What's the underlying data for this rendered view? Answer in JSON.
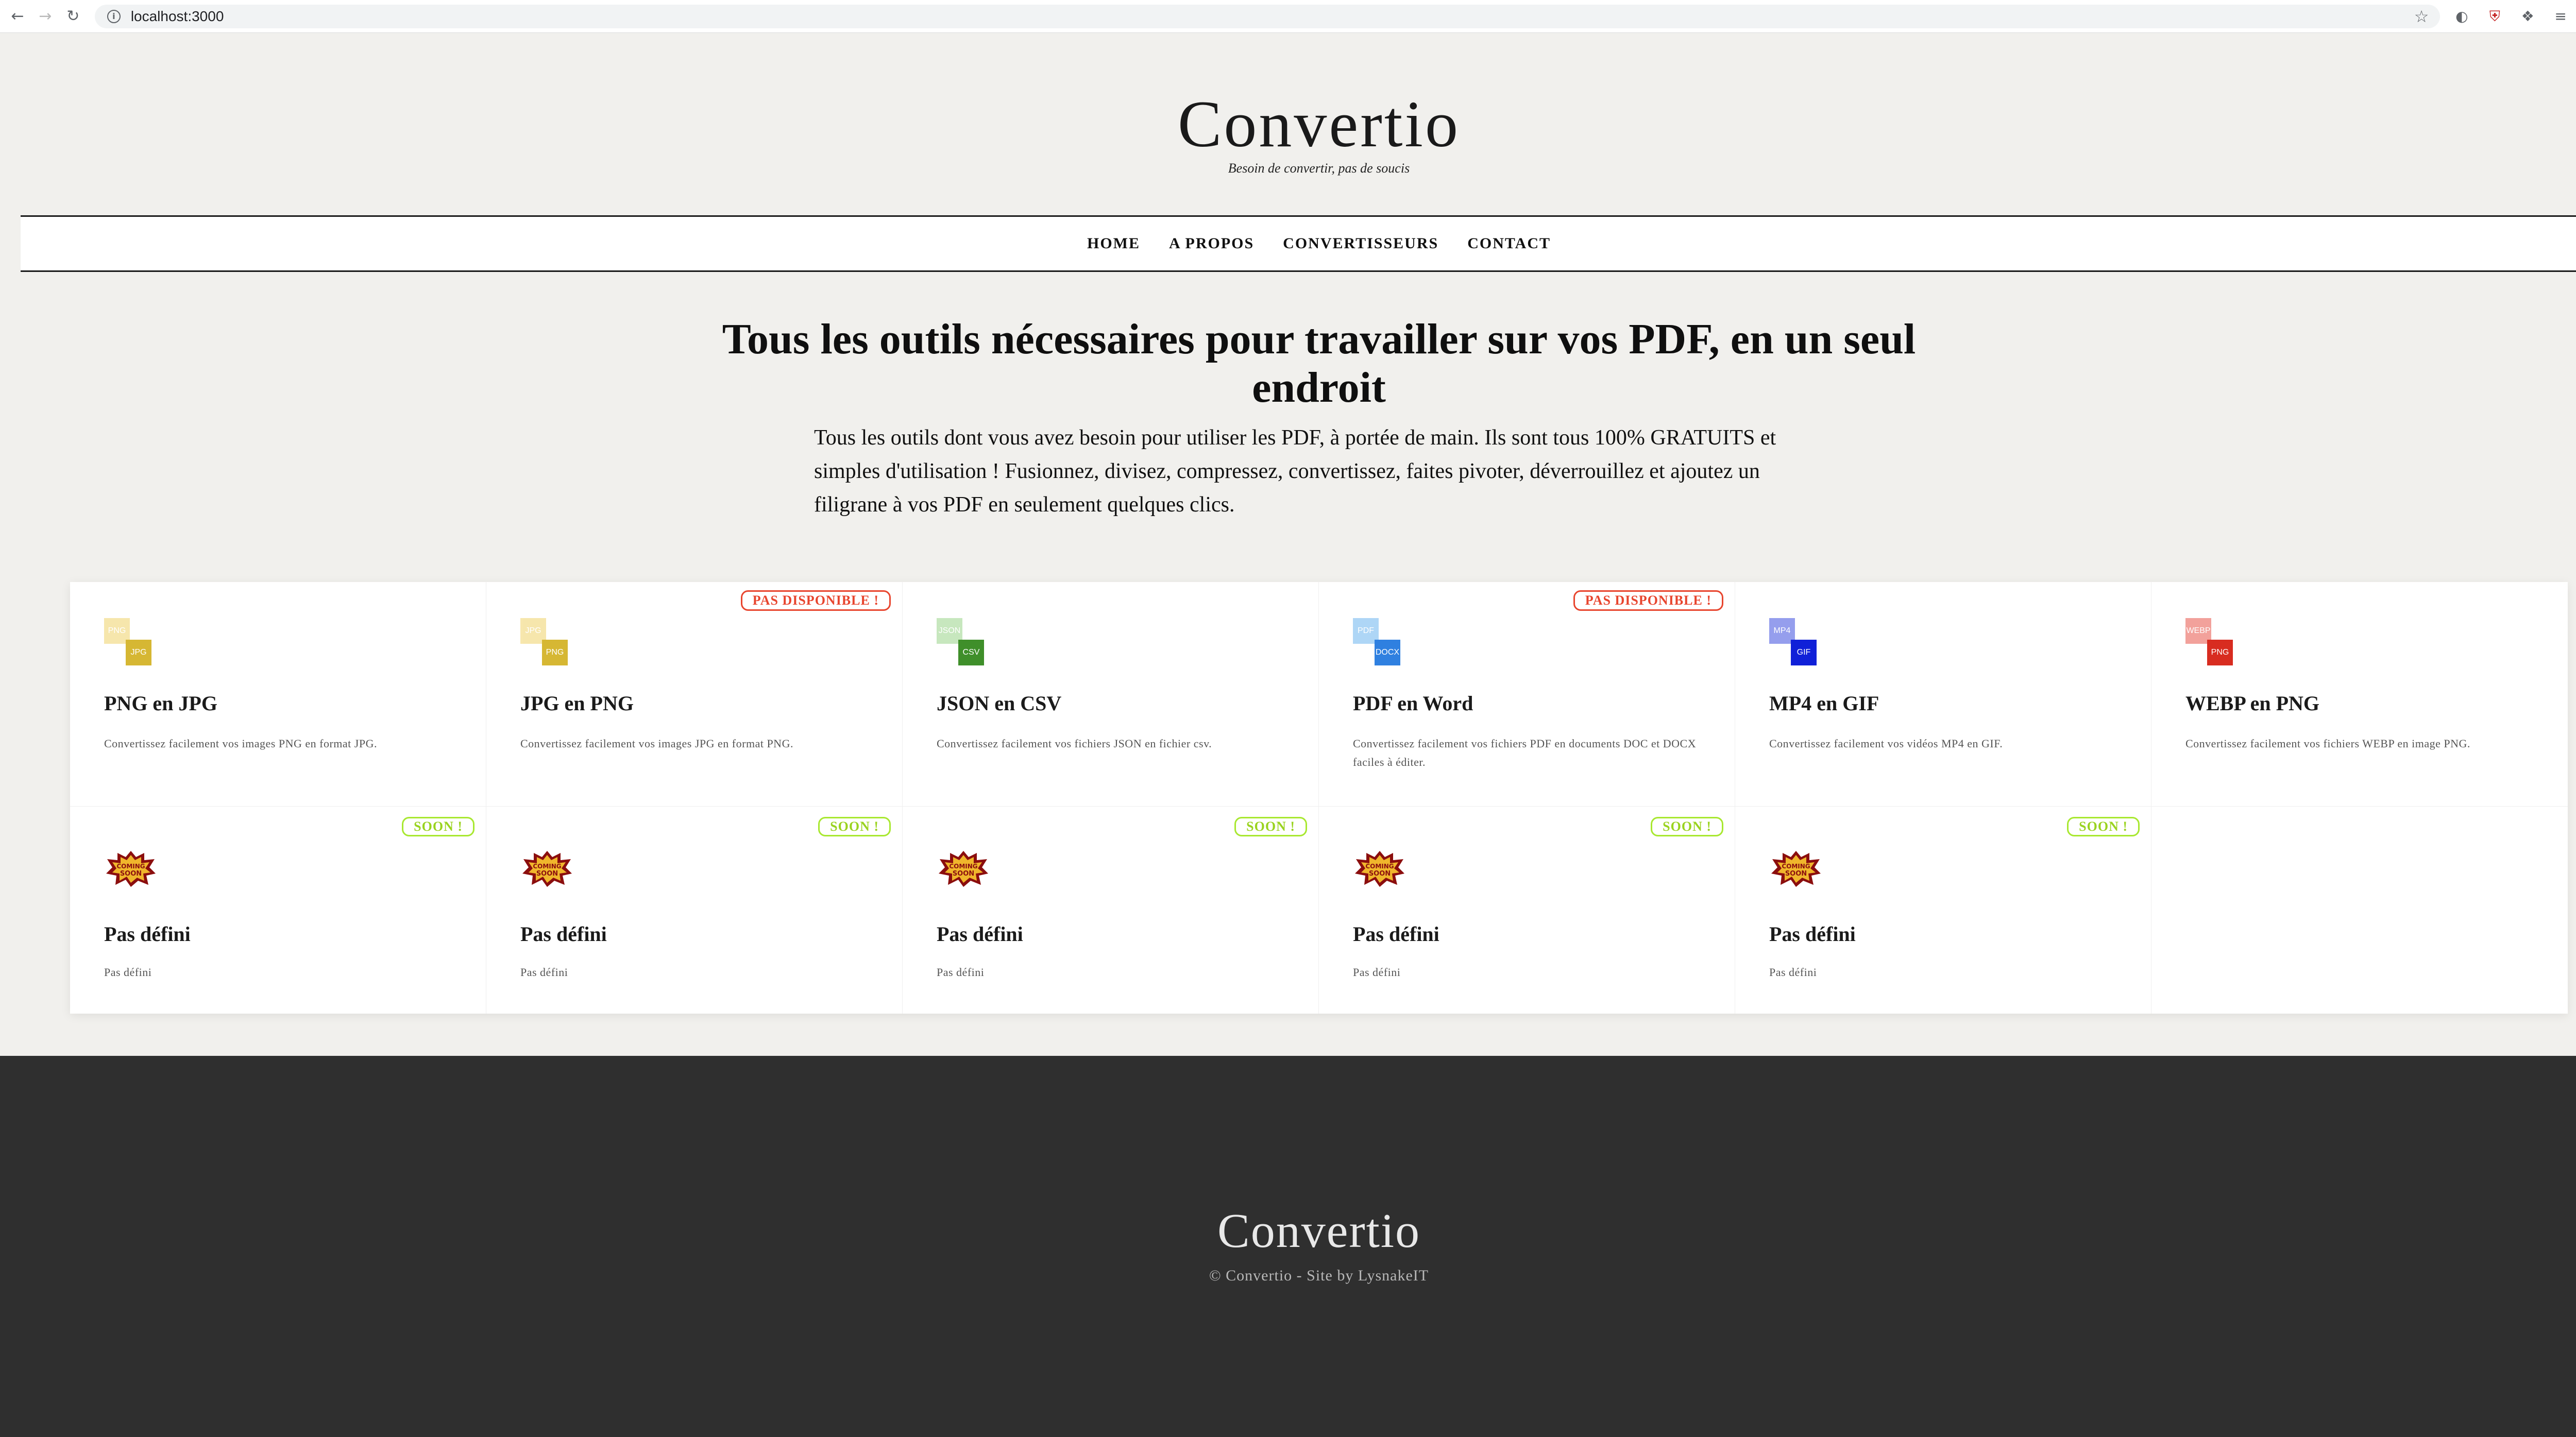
{
  "browser": {
    "url": "localhost:3000",
    "back_icon": "arrow-left",
    "forward_icon": "arrow-right",
    "reload_icon": "reload",
    "bookmark_icon": "star"
  },
  "header": {
    "brand": "Convertio",
    "tagline": "Besoin de convertir, pas de soucis"
  },
  "nav": {
    "items": [
      "HOME",
      "A PROPOS",
      "CONVERTISSEURS",
      "CONTACT"
    ]
  },
  "hero": {
    "title": "Tous les outils nécessaires pour travailler sur vos PDF, en un seul endroit",
    "description": "Tous les outils dont vous avez besoin pour utiliser les PDF, à portée de main. Ils sont tous 100% GRATUITS et simples d'utilisation ! Fusionnez, divisez, compressez, convertissez, faites pivoter, déverrouillez et ajoutez un filigrane à vos PDF en seulement quelques clics."
  },
  "converters": [
    {
      "title": "PNG en JPG",
      "desc": "Convertissez facilement vos images PNG en format JPG.",
      "badge": "",
      "from": "PNG",
      "to": "JPG",
      "from_color": "#f0d36a",
      "to_color": "#d6b733"
    },
    {
      "title": "JPG en PNG",
      "desc": "Convertissez facilement vos images JPG en format PNG.",
      "badge": "PAS DISPONIBLE !",
      "from": "JPG",
      "to": "PNG",
      "from_color": "#f0d36a",
      "to_color": "#d6b733"
    },
    {
      "title": "JSON en CSV",
      "desc": "Convertissez facilement vos fichiers JSON en fichier csv.",
      "badge": "",
      "from": "JSON",
      "to": "CSV",
      "from_color": "#9bd48a",
      "to_color": "#3f8f2a"
    },
    {
      "title": "PDF en Word",
      "desc": "Convertissez facilement vos fichiers PDF en documents DOC et DOCX faciles à éditer.",
      "badge": "PAS DISPONIBLE !",
      "from": "PDF",
      "to": "DOCX",
      "from_color": "#6cb6f0",
      "to_color": "#2f80e0"
    },
    {
      "title": "MP4 en GIF",
      "desc": "Convertissez facilement vos vidéos MP4 en GIF.",
      "badge": "",
      "from": "MP4",
      "to": "GIF",
      "from_color": "#3f4fe0",
      "to_color": "#1020d8"
    },
    {
      "title": "WEBP en PNG",
      "desc": "Convertissez facilement vos fichiers WEBP en image PNG.",
      "badge": "",
      "from": "WEBP",
      "to": "PNG",
      "from_color": "#e8564a",
      "to_color": "#d82c20"
    }
  ],
  "coming": [
    {
      "title": "Pas défini",
      "desc": "Pas défini",
      "badge": "SOON !"
    },
    {
      "title": "Pas défini",
      "desc": "Pas défini",
      "badge": "SOON !"
    },
    {
      "title": "Pas défini",
      "desc": "Pas défini",
      "badge": "SOON !"
    },
    {
      "title": "Pas défini",
      "desc": "Pas défini",
      "badge": "SOON !"
    },
    {
      "title": "Pas défini",
      "desc": "Pas défini",
      "badge": "SOON !"
    }
  ],
  "coming_icon_text": [
    "COMING",
    "SOON"
  ],
  "footer": {
    "brand": "Convertio",
    "copyright": "© Convertio - Site by LysnakeIT"
  }
}
